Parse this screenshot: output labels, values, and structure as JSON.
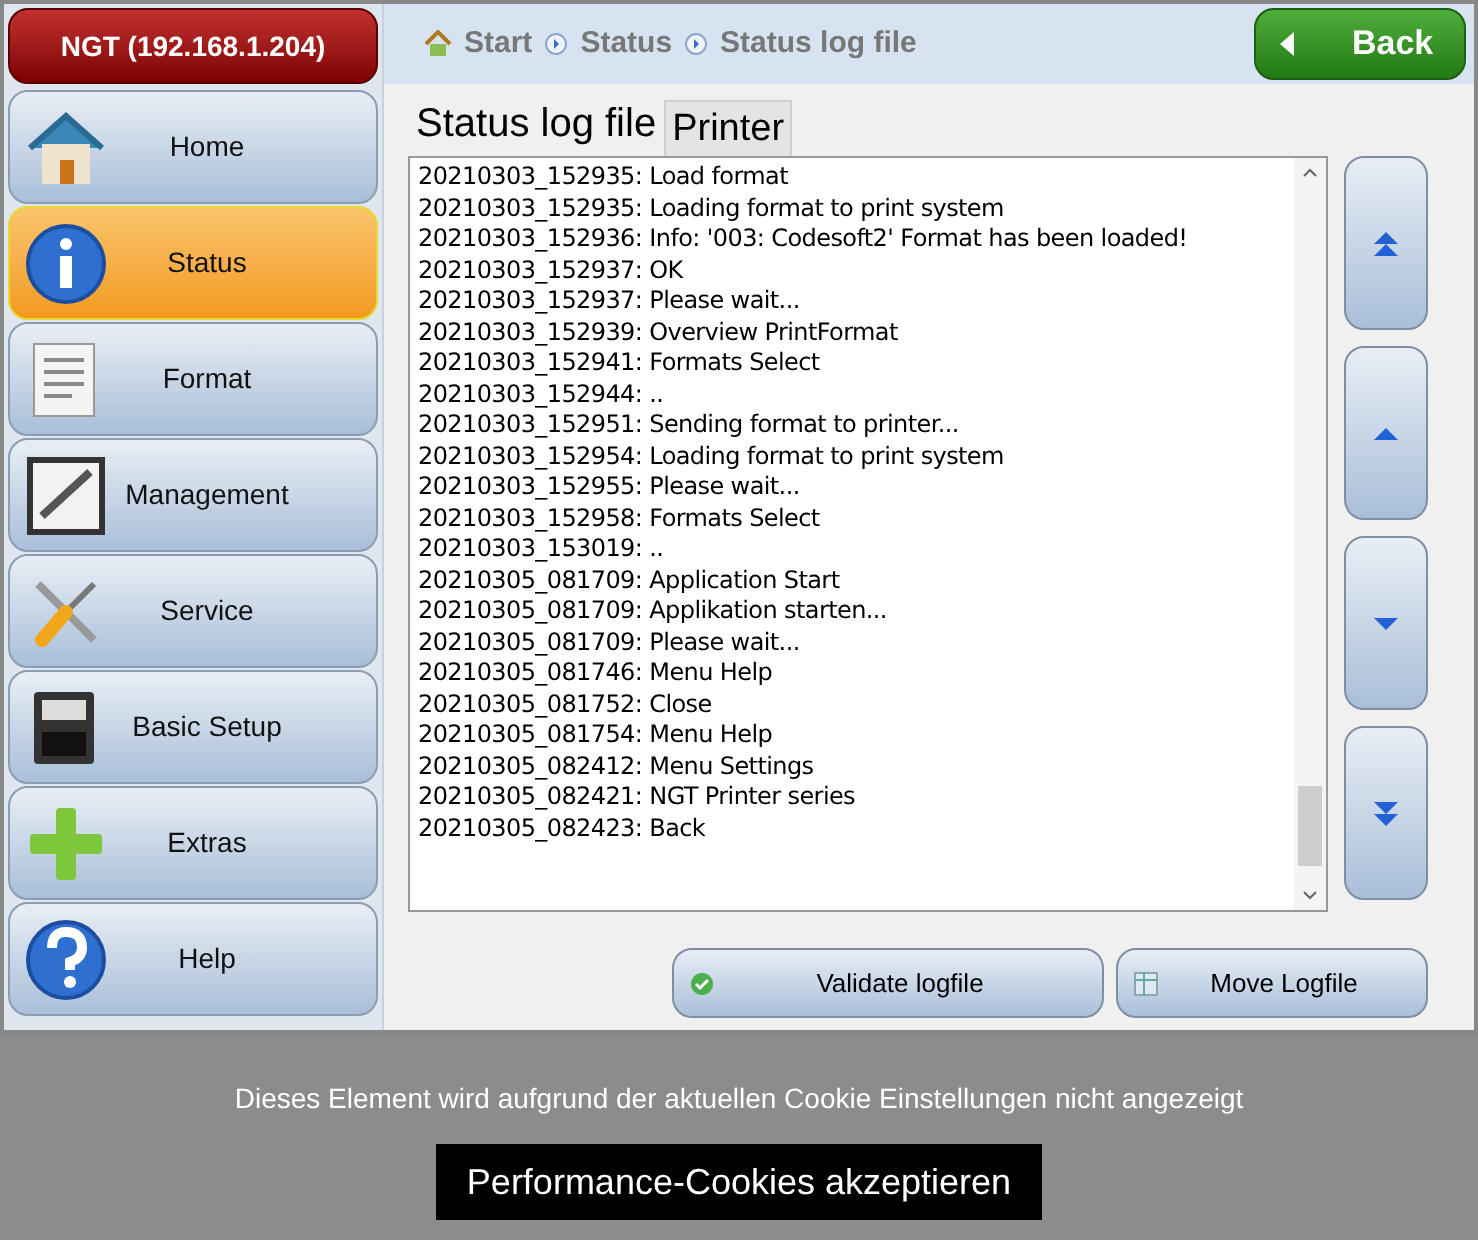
{
  "device": {
    "label": "NGT (192.168.1.204)"
  },
  "sidebar": {
    "items": [
      {
        "label": "Home",
        "kind": "house",
        "selected": false
      },
      {
        "label": "Status",
        "kind": "info",
        "selected": true
      },
      {
        "label": "Format",
        "kind": "document",
        "selected": false
      },
      {
        "label": "Management",
        "kind": "pen",
        "selected": false
      },
      {
        "label": "Service",
        "kind": "tools",
        "selected": false
      },
      {
        "label": "Basic Setup",
        "kind": "printer",
        "selected": false
      },
      {
        "label": "Extras",
        "kind": "plus",
        "selected": false
      },
      {
        "label": "Help",
        "kind": "help",
        "selected": false
      }
    ]
  },
  "breadcrumb": [
    "Start",
    "Status",
    "Status log file"
  ],
  "back_button": {
    "label": "Back"
  },
  "tabs": [
    {
      "label": "Status log file",
      "selected": true
    },
    {
      "label": "Printer",
      "selected": false
    }
  ],
  "log_lines": [
    "20210303_152935: Load format",
    "20210303_152935: Loading format to print system",
    "20210303_152936: Info: '003: Codesoft2' Format has been loaded!",
    "20210303_152937: OK",
    "20210303_152937: Please wait...",
    "20210303_152939: Overview PrintFormat",
    "20210303_152941: Formats Select",
    "20210303_152944: ..",
    "20210303_152951: Sending format to printer...",
    "20210303_152954: Loading format to print system",
    "20210303_152955: Please wait...",
    "20210303_152958: Formats Select",
    "20210303_153019: ..",
    "20210305_081709: Application Start",
    "20210305_081709: Applikation starten...",
    "20210305_081709: Please wait...",
    "20210305_081746: Menu Help",
    "20210305_081752: Close",
    "20210305_081754: Menu Help",
    "20210305_082412: Menu Settings",
    "20210305_082421: NGT Printer series",
    "20210305_082423: Back"
  ],
  "scroll_buttons": [
    {
      "kind": "top"
    },
    {
      "kind": "up"
    },
    {
      "kind": "down"
    },
    {
      "kind": "bottom"
    }
  ],
  "actions": [
    {
      "label": "Validate logfile",
      "kind": "validate"
    },
    {
      "label": "Move Logfile",
      "kind": "move"
    }
  ],
  "cookie_notice": {
    "message": "Dieses Element wird aufgrund der aktuellen Cookie Einstellungen nicht angezeigt",
    "button": "Performance-Cookies akzeptieren"
  }
}
